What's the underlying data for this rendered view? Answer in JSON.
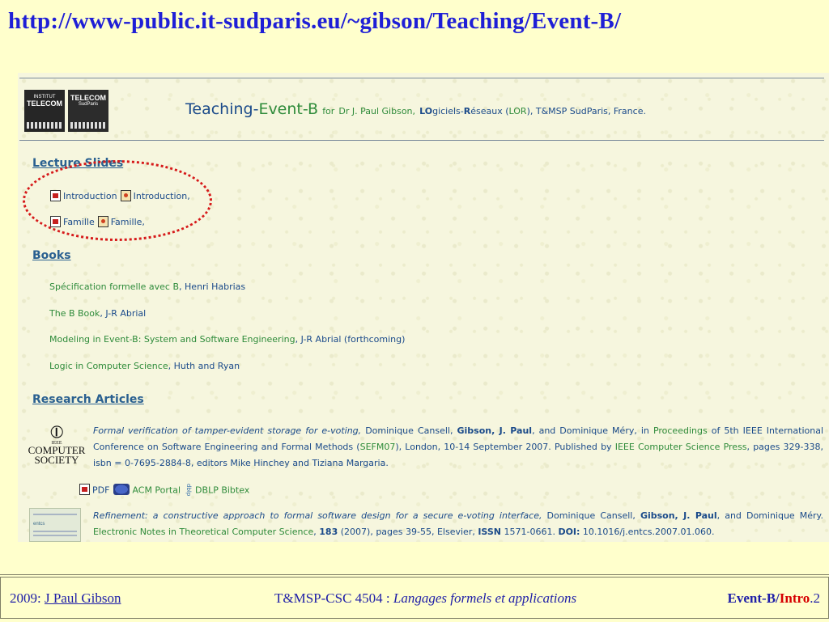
{
  "slide_url": "http://www-public.it-sudparis.eu/~gibson/Teaching/Event-B/",
  "header": {
    "logos": [
      {
        "line1": "INSTITUT",
        "line2": "TELECOM"
      },
      {
        "line1": "TELECOM",
        "line2": "SudParis"
      }
    ],
    "title_teaching": "Teaching-",
    "title_eventb": "Event-B",
    "for": "for",
    "author": "Dr J. Paul Gibson,",
    "lo": "LO",
    "giciels": "giciels-",
    "r": "R",
    "eseaux": "éseaux (",
    "lor": "LOR",
    "rest": "), T&MSP SudParis, France."
  },
  "lecture_slides": {
    "title": "Lecture Slides",
    "items": [
      {
        "pdf": "Introduction",
        "ppt": "Introduction,"
      },
      {
        "pdf": "Famille",
        "ppt": "Famille,"
      }
    ]
  },
  "books": {
    "title": "Books",
    "items": [
      {
        "title": "Spécification formelle avec B",
        "author": ", Henri Habrias"
      },
      {
        "title": "The B Book",
        "author": ", J-R Abrial"
      },
      {
        "title": "Modeling in Event-B: System and Software Engineering",
        "author": ", J-R Abrial (forthcoming)"
      },
      {
        "title": "Logic in Computer Science",
        "author": ", Huth and Ryan"
      }
    ]
  },
  "research": {
    "title": "Research Articles",
    "ieee": {
      "small": "IEEE",
      "line1": "COMPUTER",
      "line2": "SOCIETY"
    },
    "article1": {
      "title": "Formal verification of tamper-evident storage for e-voting,",
      "authors_pre": " Dominique Cansell, ",
      "gibson": "Gibson, J. Paul",
      "authors_post": ", and Dominique Méry, in ",
      "proceedings": "Proceedings",
      "conf": " of 5th IEEE International Conference on Software Engineering and Formal Methods (",
      "sefm": "SEFM07",
      "rest": "), London, 10-14 September 2007. Published by ",
      "publisher": "IEEE Computer Science Press",
      "pages": ", pages 329-338",
      "isbn": ", isbn = 0-7695-2884-8, editors Mike Hinchey and Tiziana Margaria."
    },
    "links": {
      "pdf": "PDF",
      "acm": "ACM Portal",
      "dblp_icon": "dblp",
      "dblp": "DBLP Bibtex"
    },
    "journal": {
      "label": "entcs"
    },
    "article2": {
      "title": "Refinement: a constructive approach to formal software design for a secure e-voting interface,",
      "authors_pre": " Dominique Cansell, ",
      "gibson": "Gibson, J. Paul",
      "authors_post": ", and Dominique Méry. ",
      "journal": "Electronic Notes in Theoretical Computer Science",
      "sep": ", ",
      "vol": "183",
      "rest": " (2007), pages 39-55, Elsevier, ",
      "issn_label": "ISSN",
      "issn": " 1571-0661. ",
      "doi_label": "DOI:",
      "doi": " 10.1016/j.entcs.2007.01.060."
    }
  },
  "footer": {
    "year": "2009: ",
    "author": "J Paul Gibson",
    "course": "T&MSP-CSC 4504 : ",
    "course_title": "Langages formels et applications",
    "event": "Event-B/",
    "intro": "Intro",
    "page": ".2"
  },
  "colors": {
    "background": "#ffffcc",
    "url": "#1f1fd6",
    "link_blue": "#1a4a8a",
    "link_green": "#2e8b3a",
    "highlight": "#d61a1a"
  }
}
